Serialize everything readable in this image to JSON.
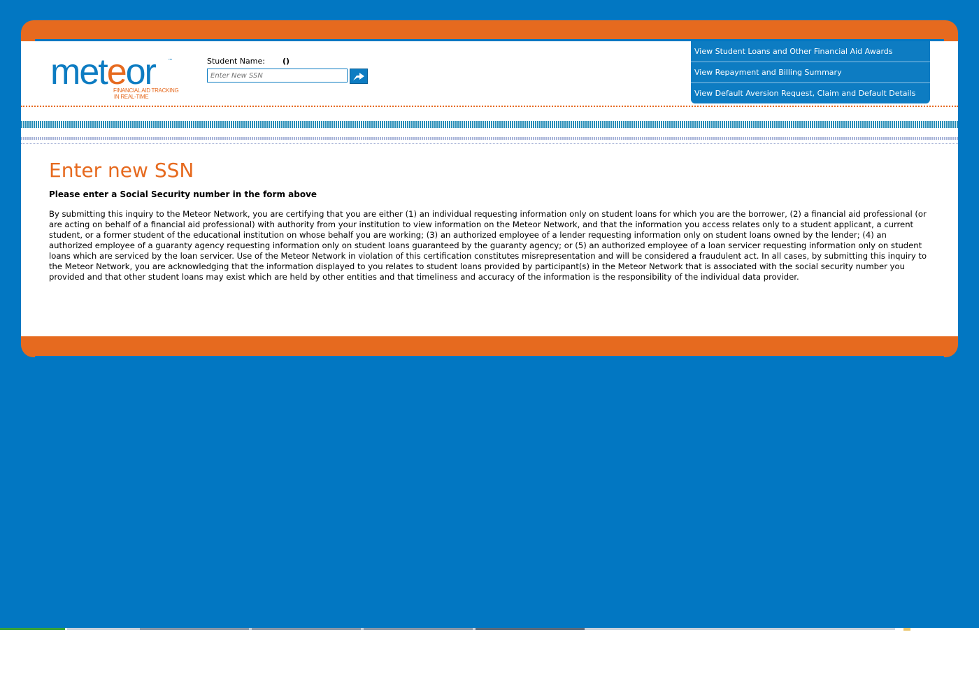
{
  "colors": {
    "page_bg": "#0277c2",
    "orange": "#e66a1f",
    "blue": "#0d7cc2",
    "content_bg": "#ffffff"
  },
  "logo": {
    "word_pre": "met",
    "word_o": "e",
    "word_post": "or",
    "tagline_1": "FINANCIAL AID TRACKING",
    "tagline_2": "IN REAL-TIME",
    "trademark": "™"
  },
  "student": {
    "name_label": "Student Name:",
    "name_value": "()",
    "ssn_placeholder": "Enter New SSN",
    "go_icon": "arrow-go-icon"
  },
  "nav": {
    "items": [
      {
        "label": "View Student Loans and Other Financial Aid Awards"
      },
      {
        "label": "View Repayment and Billing Summary"
      },
      {
        "label": "View Default Aversion Request, Claim and Default Details"
      }
    ]
  },
  "main": {
    "title": "Enter new SSN",
    "instruction": "Please enter a Social Security number in the form above",
    "disclaimer": "By submitting this inquiry to the Meteor Network, you are certifying that you are either (1) an individual requesting information only on student loans for which you are the borrower, (2) a financial aid professional (or are acting on behalf of a financial aid professional) with authority from your institution to view information on the Meteor Network, and that the information you access relates only to a student applicant, a current student, or a former student of the educational institution on whose behalf you are working; (3) an authorized employee of a lender requesting information only on student loans owned by the lender; (4) an authorized employee of a guaranty agency requesting information only on student loans guaranteed by the guaranty agency; or (5) an authorized employee of a loan servicer requesting information only on student loans which are serviced by the loan servicer. Use of the Meteor Network in violation of this certification constitutes misrepresentation and will be considered a fraudulent act. In all cases, by submitting this inquiry to the Meteor Network, you are acknowledging that the information displayed to you relates to student loans provided by participant(s) in the Meteor Network that is associated with the social security number you provided and that other student loans may exist which are held by other entities and that timeliness and accuracy of the information is the responsibility of the individual data provider."
  }
}
